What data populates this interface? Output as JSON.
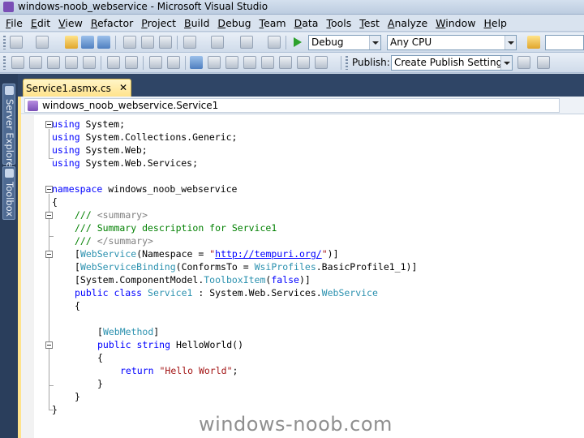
{
  "window": {
    "title": "windows-noob_webservice - Microsoft Visual Studio"
  },
  "menu": [
    "File",
    "Edit",
    "View",
    "Refactor",
    "Project",
    "Build",
    "Debug",
    "Team",
    "Data",
    "Tools",
    "Test",
    "Analyze",
    "Window",
    "Help"
  ],
  "toolbar": {
    "config": "Debug",
    "platform": "Any CPU",
    "publish_label": "Publish:",
    "publish_setting": "Create Publish Settings"
  },
  "side_tabs": {
    "server_explorer": "Server Explorer",
    "toolbox": "Toolbox"
  },
  "doc_tab": {
    "label": "Service1.asmx.cs",
    "close": "✕"
  },
  "navigation": {
    "selected_type": "windows_noob_webservice.Service1"
  },
  "code": {
    "l1_kw": "using",
    "l1_rest": " System;",
    "l2_kw": "using",
    "l2_rest": " System.Collections.Generic;",
    "l3_kw": "using",
    "l3_rest": " System.Web;",
    "l4_kw": "using",
    "l4_rest": " System.Web.Services;",
    "ns_kw": "namespace",
    "ns_name": " windows_noob_webservice",
    "brace_open": "{",
    "c1_a": "/// ",
    "c1_b": "<summary>",
    "c2": "/// Summary description for Service1",
    "c3_a": "/// ",
    "c3_b": "</summary>",
    "a1_open": "[",
    "a1_type": "WebService",
    "a1_mid": "(Namespace = ",
    "a1_q1": "\"",
    "a1_url": "http://tempuri.org/",
    "a1_q2": "\"",
    "a1_close": ")]",
    "a2_open": "[",
    "a2_type": "WebServiceBinding",
    "a2_mid": "(ConformsTo = ",
    "a2_enum": "WsiProfiles",
    "a2_rest": ".BasicProfile1_1)]",
    "a3_a": "[System.ComponentModel.",
    "a3_type": "ToolboxItem",
    "a3_b": "(",
    "a3_kw": "false",
    "a3_c": ")]",
    "cls_kw": "public class",
    "cls_sp": " ",
    "cls_name": "Service1",
    "cls_mid": " : System.Web.Services.",
    "cls_base": "WebService",
    "cls_brace": "{",
    "wm_open": "[",
    "wm_type": "WebMethod",
    "wm_close": "]",
    "m_kw": "public string",
    "m_name": " HelloWorld()",
    "m_brace": "{",
    "ret_kw": "return",
    "ret_sp": " ",
    "ret_str": "\"Hello World\"",
    "ret_end": ";",
    "m_brace_close": "}",
    "cls_brace_close": "}",
    "brace_close": "}"
  },
  "watermark": "windows-noob.com"
}
